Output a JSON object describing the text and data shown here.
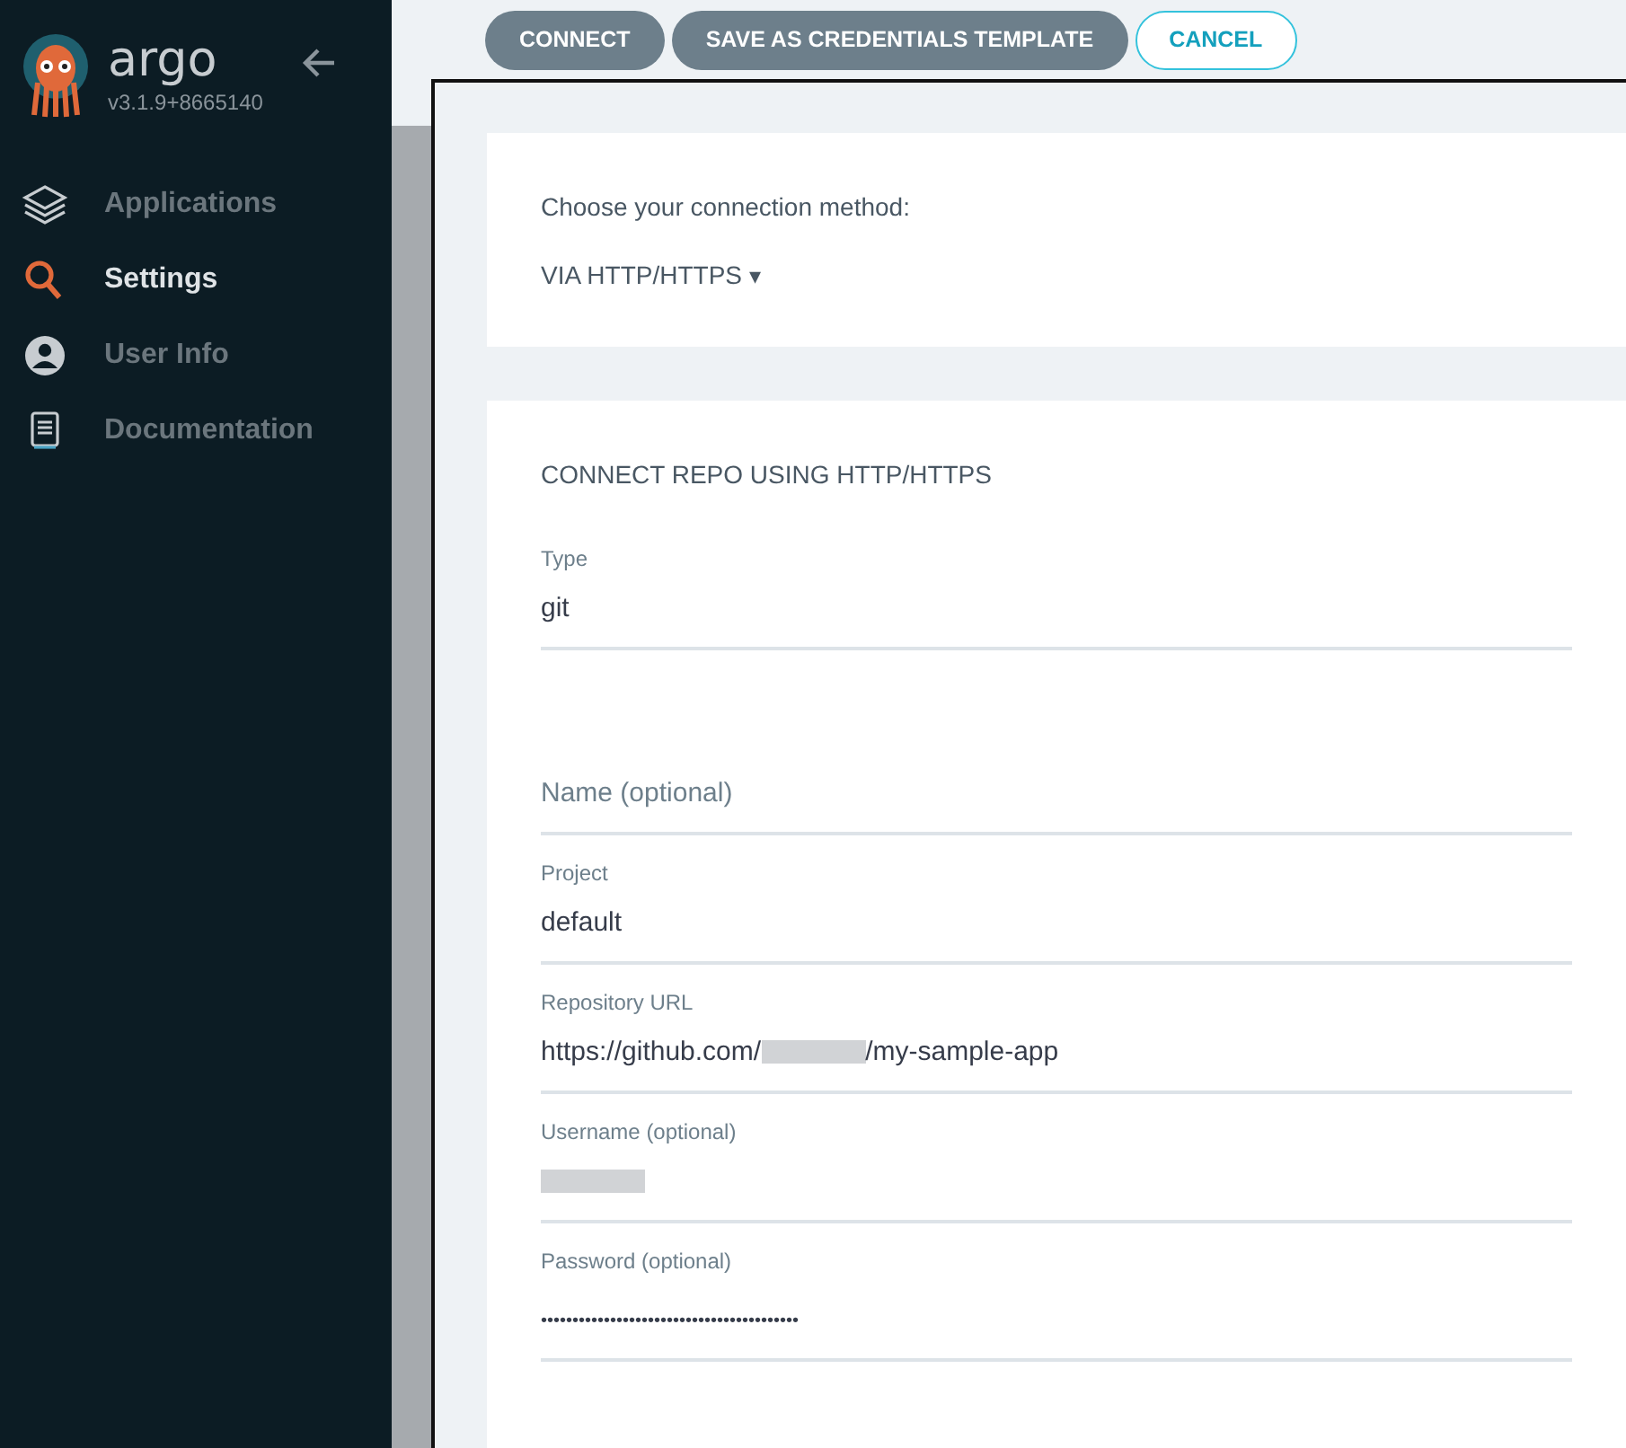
{
  "sidebar": {
    "brand": "argo",
    "version": "v3.1.9+8665140",
    "items": [
      {
        "label": "Applications",
        "selected": false
      },
      {
        "label": "Settings",
        "selected": true
      },
      {
        "label": "User Info",
        "selected": false
      },
      {
        "label": "Documentation",
        "selected": false
      }
    ]
  },
  "toolbar": {
    "buttons": [
      {
        "label": "CONNECT",
        "kind": "filled"
      },
      {
        "label": "SAVE AS CREDENTIALS TEMPLATE",
        "kind": "filled"
      },
      {
        "label": "CANCEL",
        "kind": "outline"
      }
    ]
  },
  "method_card": {
    "prompt": "Choose your connection method:",
    "method": "VIA HTTP/HTTPS",
    "caret": "▾"
  },
  "form": {
    "title": "CONNECT REPO USING HTTP/HTTPS",
    "fields": [
      {
        "kind": "text",
        "label": "Type",
        "value": "git"
      },
      {
        "kind": "placeholder",
        "placeholder": "Name (optional)"
      },
      {
        "kind": "text",
        "label": "Project",
        "value": "default"
      },
      {
        "kind": "redacted",
        "label": "Repository URL",
        "prefix": "https://github.com/",
        "suffix": "/my-sample-app"
      },
      {
        "kind": "redacted",
        "label": "Username (optional)"
      },
      {
        "kind": "password",
        "label": "Password (optional)",
        "value": "•••••••••••••••••••••••••••••••••••••••••"
      }
    ]
  }
}
